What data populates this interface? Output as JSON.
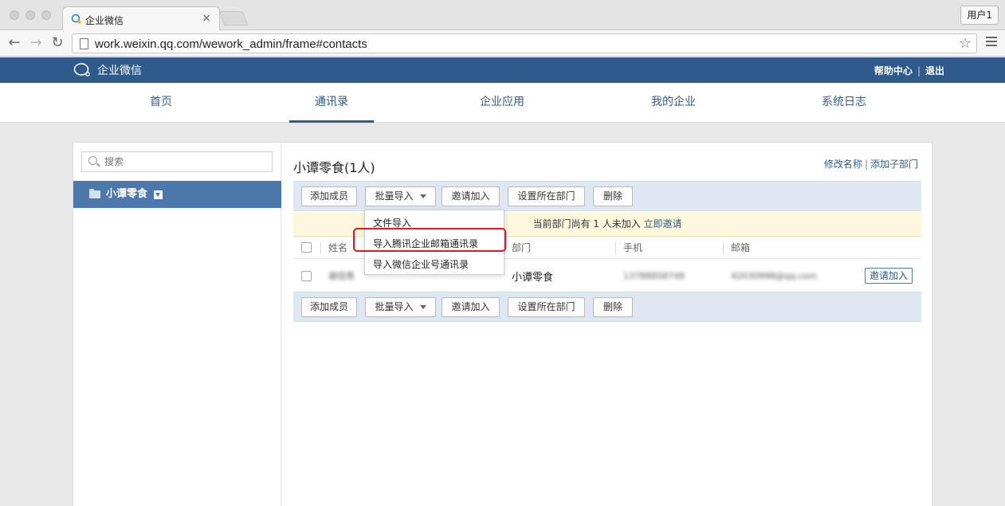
{
  "browser": {
    "tab_title": "企业微信",
    "tab_close": "×",
    "user_button": "用户1",
    "back": "←",
    "forward": "→",
    "reload": "↻",
    "url": "work.weixin.qq.com/wework_admin/frame#contacts",
    "star": "☆"
  },
  "header": {
    "brand": "企业微信",
    "help": "帮助中心",
    "logout": "退出"
  },
  "nav": {
    "items": [
      {
        "label": "首页",
        "active": false
      },
      {
        "label": "通讯录",
        "active": true
      },
      {
        "label": "企业应用",
        "active": false
      },
      {
        "label": "我的企业",
        "active": false
      },
      {
        "label": "系统日志",
        "active": false
      }
    ]
  },
  "sidebar": {
    "search_placeholder": "搜索",
    "department": "小谭零食"
  },
  "main": {
    "title": "小谭零食(1人)",
    "rename_link": "修改名称",
    "add_sub_link": "添加子部门",
    "toolbar": {
      "add_member": "添加成员",
      "batch_import": "批量导入",
      "invite": "邀请加入",
      "set_department": "设置所在部门",
      "delete": "删除"
    },
    "notice": {
      "text": "当前部门尚有 1 人未加入",
      "link": "立即邀请"
    },
    "table": {
      "headers": {
        "name": "姓名",
        "department": "部门",
        "phone": "手机",
        "email": "邮箱"
      },
      "rows": [
        {
          "name": "谢佳秀",
          "department": "小谭零食",
          "phone": "13788858748",
          "email": "42030998@qq.com",
          "action": "邀请加入"
        }
      ]
    },
    "dropdown": {
      "options": [
        "文件导入",
        "导入腾讯企业邮箱通讯录",
        "导入微信企业号通讯录"
      ],
      "highlighted_index": 1
    }
  },
  "colors": {
    "header_bg": "#2e5b8b",
    "active_dept": "#4c78ac",
    "action_bar": "#dfe7f2",
    "notice_bg": "#fdf7dd",
    "highlight_border": "#e0181c"
  }
}
